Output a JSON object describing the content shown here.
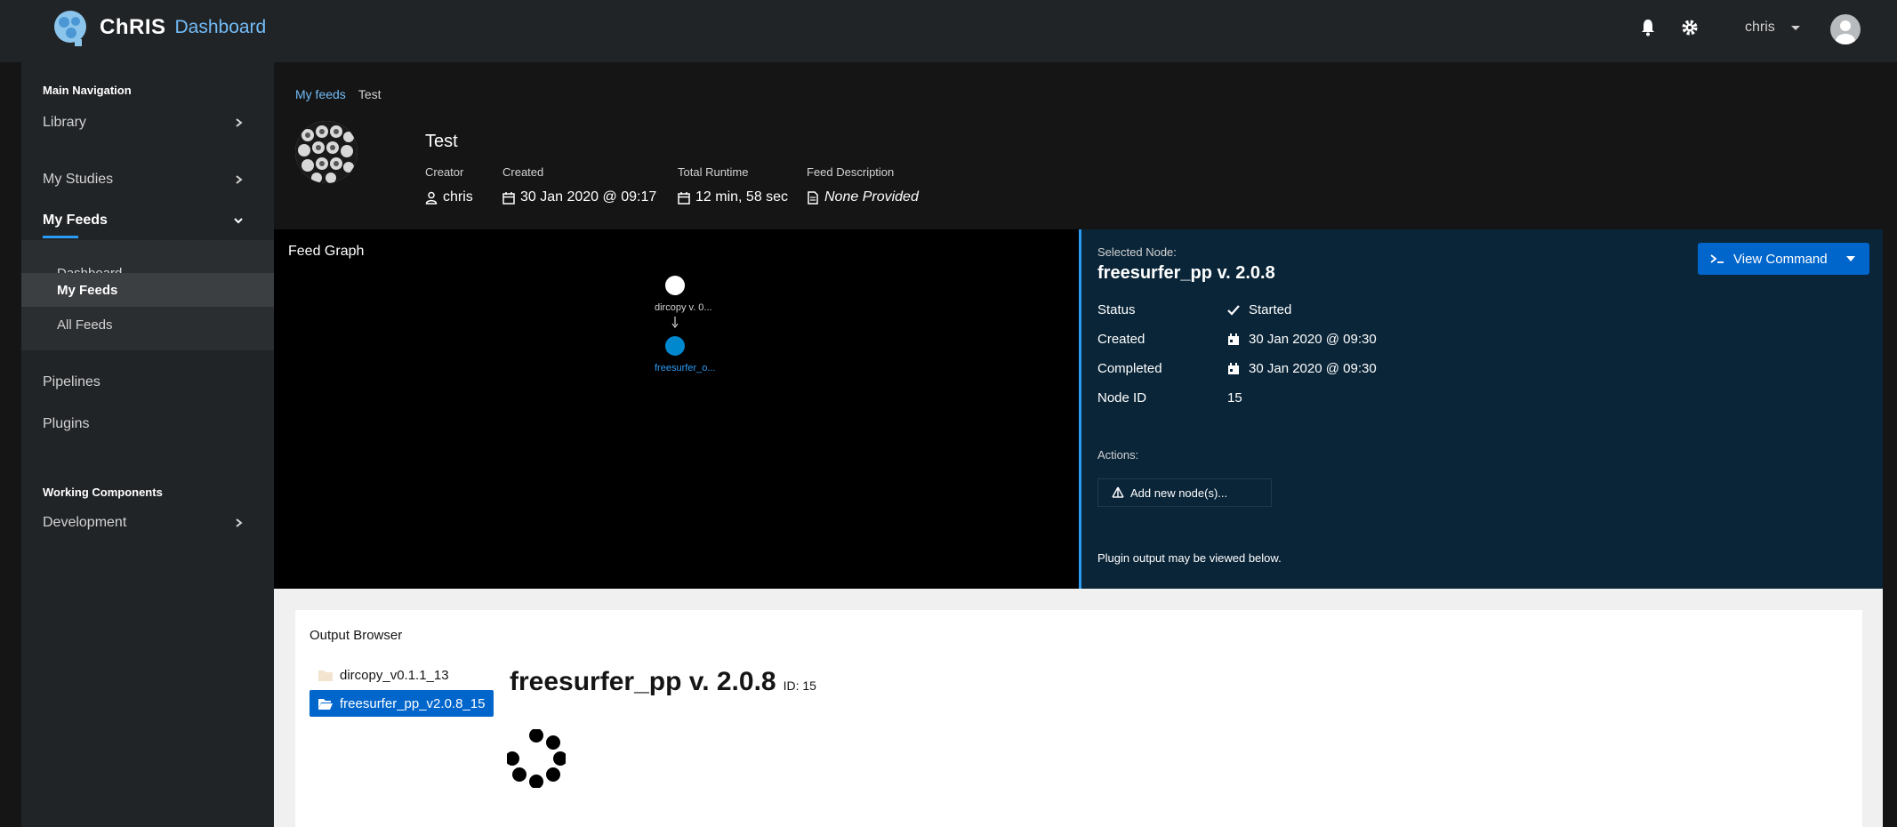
{
  "app": {
    "title": "ChRIS",
    "subtitle": "Dashboard"
  },
  "header": {
    "user": "chris",
    "icons": [
      "bell-icon",
      "gear-icon",
      "caret-down-icon",
      "avatar-icon"
    ]
  },
  "sidebar": {
    "section_main": "Main Navigation",
    "items": [
      {
        "label": "Library"
      },
      {
        "label": "My Studies"
      },
      {
        "label": "My Feeds"
      },
      {
        "label": "Pipelines"
      },
      {
        "label": "Plugins"
      }
    ],
    "sub_items": [
      {
        "label": "Dashboard"
      },
      {
        "label": "My Feeds"
      },
      {
        "label": "All Feeds"
      }
    ],
    "section_working": "Working Components",
    "dev_label": "Development"
  },
  "breadcrumb": {
    "link": "My feeds",
    "current": "Test"
  },
  "feed": {
    "title": "Test",
    "creator_label": "Creator",
    "creator": "chris",
    "created_label": "Created",
    "created": "30 Jan 2020 @ 09:17",
    "runtime_label": "Total Runtime",
    "runtime": "12 min, 58 sec",
    "desc_label": "Feed Description",
    "desc": "None Provided"
  },
  "graph": {
    "title": "Feed Graph",
    "nodes": [
      {
        "label": "dircopy v. 0...",
        "color": "#ffffff"
      },
      {
        "label": "freesurfer_o...",
        "color": "#0088ce"
      }
    ]
  },
  "node_panel": {
    "selected_label": "Selected Node:",
    "name": "freesurfer_pp v. 2.0.8",
    "view_command": "View Command",
    "status_label": "Status",
    "status": "Started",
    "created_label": "Created",
    "created": "30 Jan 2020 @ 09:30",
    "completed_label": "Completed",
    "completed": "30 Jan 2020 @ 09:30",
    "node_id_label": "Node ID",
    "node_id": "15",
    "actions_label": "Actions:",
    "add_node": "Add new node(s)...",
    "footer": "Plugin output may be viewed below."
  },
  "output": {
    "title": "Output Browser",
    "dirs": [
      {
        "label": "dircopy_v0.1.1_13",
        "active": false
      },
      {
        "label": "freesurfer_pp_v2.0.8_15",
        "active": true
      }
    ],
    "plugin_title": "freesurfer_pp v. 2.0.8",
    "plugin_id": "ID: 15"
  },
  "colors": {
    "accent": "#0066cc",
    "link": "#73bcf7",
    "panel": "#0a2538",
    "sidebar": "#212427"
  }
}
